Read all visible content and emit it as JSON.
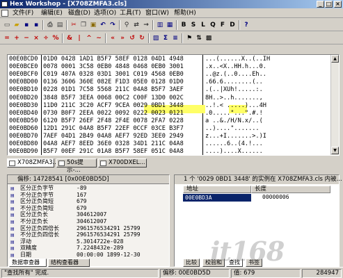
{
  "window": {
    "title": "Hex Workshop - [X708ZMFA3.cls]"
  },
  "menu": [
    "文件(F)",
    "编辑(E)",
    "磁盘(D)",
    "选项(O)",
    "工具(T)",
    "窗口(W)",
    "帮助(H)"
  ],
  "hex_rows": [
    {
      "off": "00E0BCD0",
      "hex": "01D0 0428 1AD1 B5F7 58EF 0128 04D1 4948",
      "ascii": "...(......X..(..IH"
    },
    {
      "off": "00E0BCE0",
      "hex": "0078 0001 3C58 0EB0 4848 0468 0EB0 3001",
      "ascii": ".x..<X..HH.h...0."
    },
    {
      "off": "00E0BCF0",
      "hex": "C019 407A 0328 03D1 3001 C019 4568 0EB0",
      "ascii": "..@z.(..0....Eh.."
    },
    {
      "off": "00E0BD00",
      "hex": "0136 3606 360E 082E F1D3 05E0 0128 01D0",
      "ascii": ".66.6........(.."
    },
    {
      "off": "00E0BD10",
      "hex": "0228 01D1 7C58 5568 211C 04A8 B5F7 3AEF",
      "ascii": ".(..|XUh!.....:."
    },
    {
      "off": "00E0BD20",
      "hex": "3848 B5F7 3EEA 0068 00C2 C00F 13D0 002C",
      "ascii": "8H..>..h.......,"
    },
    {
      "off": "00E0BD30",
      "hex": "11D0 211C 3C20 ACF7 9CEA 0029 0BD1 3448",
      "ascii": "..!.< .....)...4H"
    },
    {
      "off": "00E0BD40",
      "hex": "0730 B0F7 2EEA 0022 0092 0222 0023 0121",
      "ascii": ".0.....\"...\".#.!"
    },
    {
      "off": "00E0BD50",
      "hex": "6120 B5F7 26EF 2F48 2F4E 0078 2FA7 0228",
      "ascii": "a ..&./H/N.x/..("
    },
    {
      "off": "00E0BD60",
      "hex": "12D1 291C 04A8 B5F7 22EF 0CCF 03CE B3F7",
      "ascii": "..)....\"......."
    },
    {
      "off": "00E0BD70",
      "hex": "7AEF 04D1 2B49 04A8 AEF7 92ED 3EE0 2949",
      "ascii": "z...+I.......>.)I"
    },
    {
      "off": "00E0BD80",
      "hex": "04A8 AEF7 8EED 36E0 0328 34D1 211C 04A8",
      "ascii": "......6..(4.!..."
    },
    {
      "off": "00E0BD90",
      "hex": "B5F7 00EF 291C 01A8 B5F7 58EF 051C 04A8",
      "ascii": "....)....X......"
    }
  ],
  "doc_tabs": [
    "X708ZMFA3...",
    "50s提示-...",
    "X700DXEL..."
  ],
  "data_inspector": {
    "header": "偏移: 14728541 [0x00E0BD5D]",
    "rows": [
      {
        "label": "区分正负字节",
        "value": "-89"
      },
      {
        "label": "不分正负字节",
        "value": "167"
      },
      {
        "label": "区分正负简短",
        "value": "679"
      },
      {
        "label": "不分正负简短",
        "value": "679"
      },
      {
        "label": "区分正负长",
        "value": "304612007"
      },
      {
        "label": "不分正负长",
        "value": "304612007"
      },
      {
        "label": "区分正负四倍长",
        "value": "2961576534291 25799"
      },
      {
        "label": "不分正负四倍长",
        "value": "2961576534291 25799"
      },
      {
        "label": "浮动",
        "value": "5.3014722e-028"
      },
      {
        "label": "双精度",
        "value": "7.2248432e-289"
      },
      {
        "label": "日期",
        "value": "00:00:00 1899-12-30"
      }
    ],
    "tabs": [
      "数据审查器",
      "结构查看器"
    ]
  },
  "results": {
    "title": "1 个 '0029 0BD1 3448' 的实例在 X708ZMFA3.cls 内被...",
    "columns": [
      "地址",
      "长度"
    ],
    "rows": [
      {
        "address": "00E0BD3A",
        "length": "00000006"
      }
    ],
    "tabs": [
      "比较",
      "校验和",
      "查找",
      "书签"
    ]
  },
  "status": {
    "message": "\"查找所有\" 完成.",
    "offset_label": "偏移: 00E0BD5D",
    "value_label": "值: 679",
    "size": "284947"
  },
  "watermark": "it168"
}
